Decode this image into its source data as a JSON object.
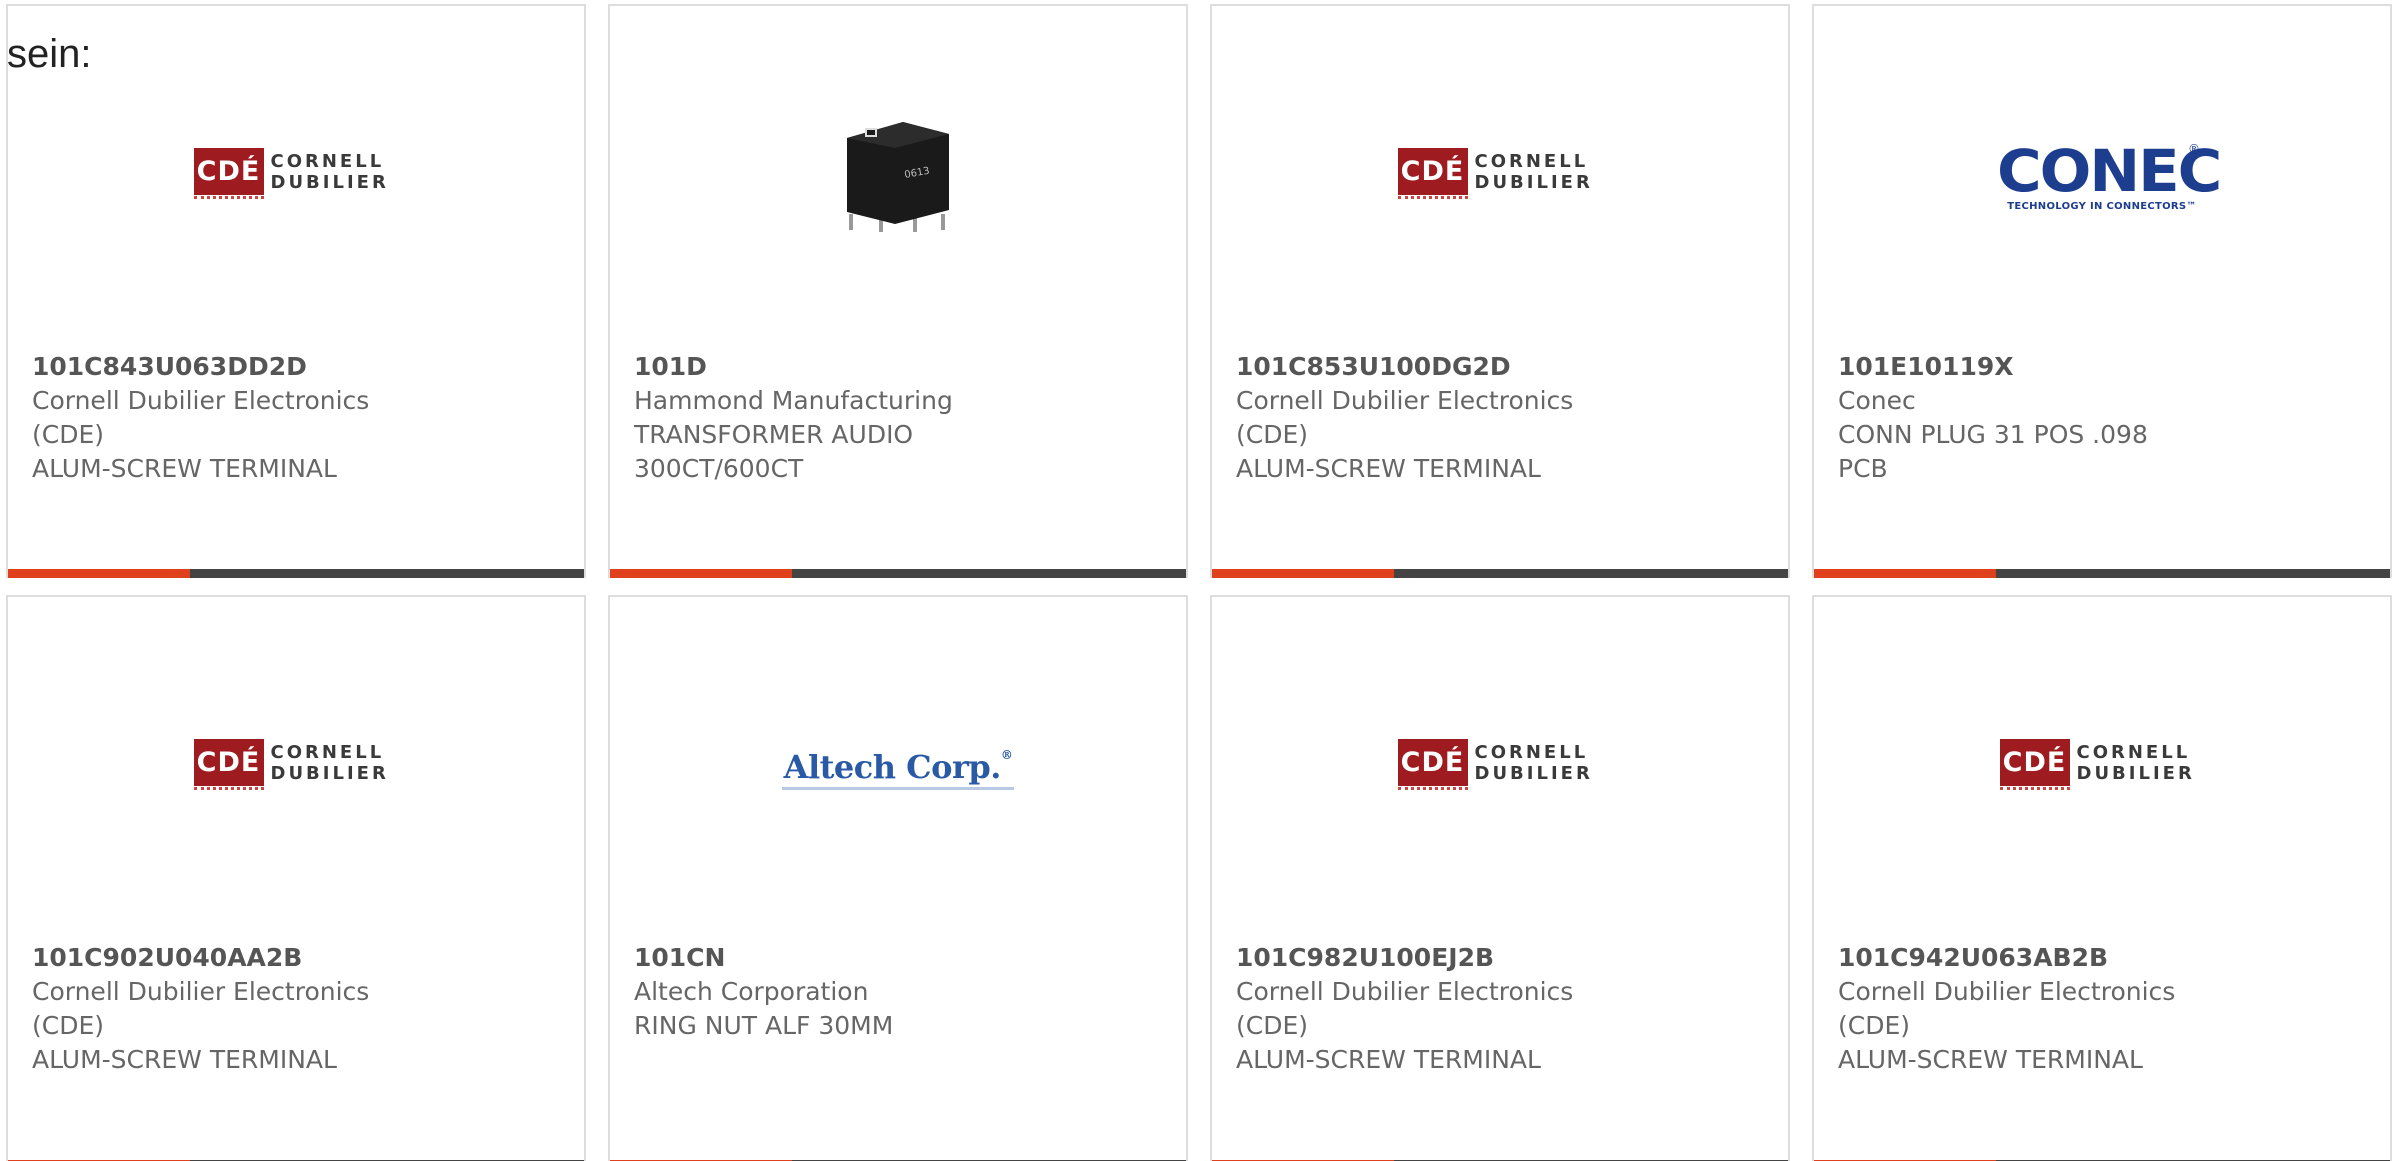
{
  "intro_text": "sein:",
  "colors": {
    "accent_bar": "#e0401b",
    "bar": "#444444",
    "card_border": "#dddddd",
    "cde_red": "#9e1b20",
    "conec_blue": "#1d3d8f",
    "altech_blue": "#2a5aa5"
  },
  "logos": {
    "cde": {
      "box_text": "CDÉ",
      "line1": "CORNELL",
      "line2": "DUBILIER"
    },
    "conec": {
      "word": "CONEC",
      "reg": "®",
      "tagline": "TECHNOLOGY IN CONNECTORS™"
    },
    "altech": {
      "word": "Altech Corp.",
      "reg": "®"
    },
    "photo_marking": "0613"
  },
  "products": [
    {
      "part_number": "101C843U063DD2D",
      "manufacturer": "Cornell Dubilier Electronics (CDE)",
      "description": "ALUM-SCREW TERMINAL",
      "image": "cde-logo"
    },
    {
      "part_number": "101D",
      "manufacturer": "Hammond Manufacturing",
      "description": "TRANSFORMER AUDIO 300CT/600CT",
      "image": "transformer-photo"
    },
    {
      "part_number": "101C853U100DG2D",
      "manufacturer": "Cornell Dubilier Electronics (CDE)",
      "description": "ALUM-SCREW TERMINAL",
      "image": "cde-logo"
    },
    {
      "part_number": "101E10119X",
      "manufacturer": "Conec",
      "description": "CONN PLUG 31 POS .098 PCB",
      "image": "conec-logo"
    },
    {
      "part_number": "101C902U040AA2B",
      "manufacturer": "Cornell Dubilier Electronics (CDE)",
      "description": "ALUM-SCREW TERMINAL",
      "image": "cde-logo"
    },
    {
      "part_number": "101CN",
      "manufacturer": "Altech Corporation",
      "description": "RING NUT ALF 30MM",
      "image": "altech-logo"
    },
    {
      "part_number": "101C982U100EJ2B",
      "manufacturer": "Cornell Dubilier Electronics (CDE)",
      "description": "ALUM-SCREW TERMINAL",
      "image": "cde-logo"
    },
    {
      "part_number": "101C942U063AB2B",
      "manufacturer": "Cornell Dubilier Electronics (CDE)",
      "description": "ALUM-SCREW TERMINAL",
      "image": "cde-logo"
    }
  ]
}
